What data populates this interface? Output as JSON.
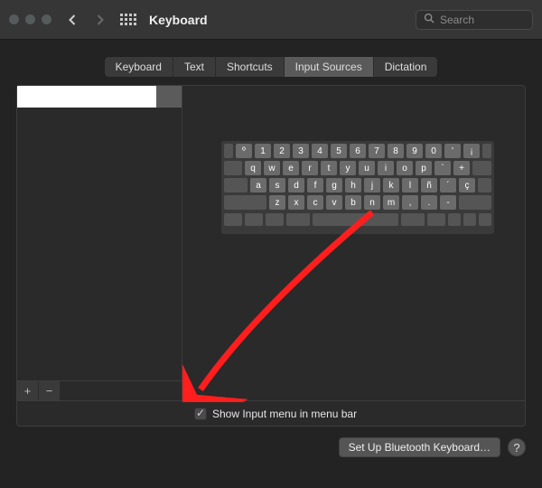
{
  "window": {
    "title": "Keyboard"
  },
  "search": {
    "placeholder": "Search"
  },
  "tabs": [
    {
      "label": "Keyboard"
    },
    {
      "label": "Text"
    },
    {
      "label": "Shortcuts"
    },
    {
      "label": "Input Sources"
    },
    {
      "label": "Dictation"
    }
  ],
  "active_tab": "Input Sources",
  "input_sources": [
    {
      "name": ""
    }
  ],
  "keyboard_rows": [
    [
      "º",
      "1",
      "2",
      "3",
      "4",
      "5",
      "6",
      "7",
      "8",
      "9",
      "0",
      "'",
      "¡"
    ],
    [
      "q",
      "w",
      "e",
      "r",
      "t",
      "y",
      "u",
      "i",
      "o",
      "p",
      "`",
      "+"
    ],
    [
      "a",
      "s",
      "d",
      "f",
      "g",
      "h",
      "j",
      "k",
      "l",
      "ñ",
      "´",
      "ç"
    ],
    [
      "z",
      "x",
      "c",
      "v",
      "b",
      "n",
      "m",
      ",",
      ".",
      "-"
    ]
  ],
  "checkbox": {
    "label": "Show Input menu in menu bar",
    "checked": true
  },
  "buttons": {
    "add": "+",
    "remove": "−",
    "bluetooth": "Set Up Bluetooth Keyboard…",
    "help": "?"
  }
}
